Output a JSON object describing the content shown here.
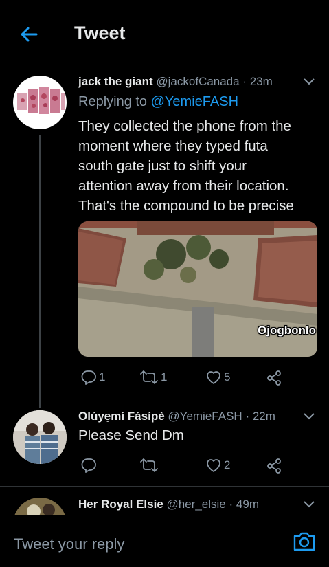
{
  "header": {
    "title": "Tweet"
  },
  "tweets": [
    {
      "name": "jack the giant",
      "handle": "@jackofCanada",
      "time": "23m",
      "replying_prefix": "Replying to ",
      "replying_to": "@YemieFASH",
      "text_lines": [
        "They collected the phone from the",
        "moment where they typed futa",
        "south gate just to shift your",
        "attention away from their location.",
        "That's the compound to be precise"
      ],
      "media_watermark": "Ojogbonlo",
      "actions": {
        "replies": "1",
        "retweets": "1",
        "likes": "5"
      }
    },
    {
      "name": "Olúyẹmí Fásípè",
      "handle": "@YemieFASH",
      "time": "22m",
      "text": "Please Send Dm",
      "actions": {
        "replies": "",
        "retweets": "",
        "likes": "2"
      }
    },
    {
      "name": "Her Royal Elsie",
      "handle": "@her_elsie",
      "time": "49m"
    }
  ],
  "composer": {
    "placeholder": "Tweet your reply"
  },
  "colors": {
    "accent": "#1d9bf0",
    "muted": "#8b98a5",
    "background": "#000000"
  },
  "icons": [
    "back-arrow-icon",
    "chevron-down-icon",
    "reply-icon",
    "retweet-icon",
    "like-icon",
    "share-icon",
    "camera-icon"
  ]
}
